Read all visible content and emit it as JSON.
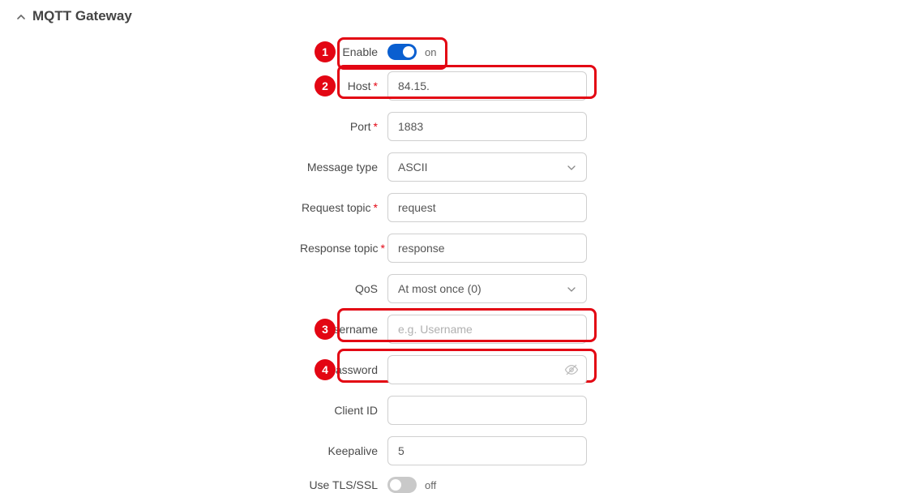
{
  "section": {
    "title": "MQTT Gateway"
  },
  "callouts": {
    "b1": "1",
    "b2": "2",
    "b3": "3",
    "b4": "4"
  },
  "labels": {
    "enable": "Enable",
    "host": "Host",
    "port": "Port",
    "message_type": "Message type",
    "request_topic": "Request topic",
    "response_topic": "Response topic",
    "qos": "QoS",
    "username": "Username",
    "password": "Password",
    "client_id": "Client ID",
    "keepalive": "Keepalive",
    "use_tls": "Use TLS/SSL",
    "star": "*"
  },
  "values": {
    "enable_status": "on",
    "host": "84.15.",
    "port": "1883",
    "message_type": "ASCII",
    "request_topic": "request",
    "response_topic": "response",
    "qos": "At most once (0)",
    "username": "",
    "password": "",
    "client_id": "",
    "keepalive": "5",
    "tls_status": "off"
  },
  "placeholders": {
    "username": "e.g. Username"
  }
}
